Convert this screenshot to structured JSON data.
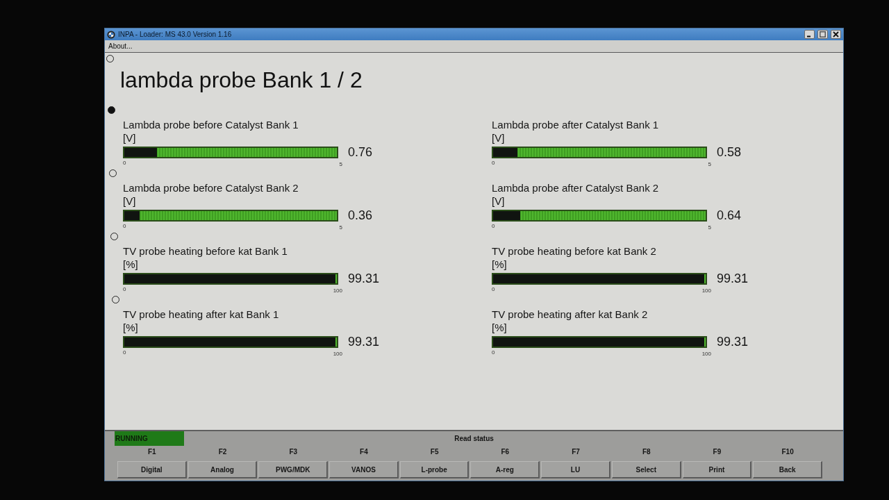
{
  "window": {
    "title": "INPA - Loader: MS 43.0 Version 1.16"
  },
  "menu": [
    "About..."
  ],
  "page_markers": [
    {
      "selected": false
    },
    {
      "selected": true
    },
    {
      "selected": false
    },
    {
      "selected": false
    },
    {
      "selected": false
    }
  ],
  "heading": "lambda probe Bank 1 / 2",
  "columns": [
    [
      {
        "label": "Lambda probe before Catalyst Bank 1",
        "unit": "[V]",
        "value": "0.76",
        "scale_min": "0",
        "scale_max": "5",
        "level": 0.152
      },
      {
        "label": "Lambda probe before Catalyst Bank 2",
        "unit": "[V]",
        "value": "0.36",
        "scale_min": "0",
        "scale_max": "5",
        "level": 0.072
      },
      {
        "label": "TV probe heating before kat Bank 1",
        "unit": "[%]",
        "value": "99.31",
        "scale_min": "0",
        "scale_max": "100",
        "level": 0.9931
      },
      {
        "label": "TV probe heating after kat Bank 1",
        "unit": "[%]",
        "value": "99.31",
        "scale_min": "0",
        "scale_max": "100",
        "level": 0.9931
      }
    ],
    [
      {
        "label": "Lambda probe after Catalyst Bank 1",
        "unit": "[V]",
        "value": "0.58",
        "scale_min": "0",
        "scale_max": "5",
        "level": 0.116
      },
      {
        "label": "Lambda probe after Catalyst Bank 2",
        "unit": "[V]",
        "value": "0.64",
        "scale_min": "0",
        "scale_max": "5",
        "level": 0.128
      },
      {
        "label": "TV probe heating before kat Bank 2",
        "unit": "[%]",
        "value": "99.31",
        "scale_min": "0",
        "scale_max": "100",
        "level": 0.9931
      },
      {
        "label": "TV probe heating after kat Bank 2",
        "unit": "[%]",
        "value": "99.31",
        "scale_min": "0",
        "scale_max": "100",
        "level": 0.9931
      }
    ]
  ],
  "status_bar": {
    "indicator": "RUNNING",
    "message": "Read status"
  },
  "function_keys": [
    {
      "key": "F1",
      "label": "Digital"
    },
    {
      "key": "F2",
      "label": "Analog"
    },
    {
      "key": "F3",
      "label": "PWG/MDK"
    },
    {
      "key": "F4",
      "label": "VANOS"
    },
    {
      "key": "F5",
      "label": "L-probe"
    },
    {
      "key": "F6",
      "label": "A-reg"
    },
    {
      "key": "F7",
      "label": "LU"
    },
    {
      "key": "F8",
      "label": "Select"
    },
    {
      "key": "F9",
      "label": "Print"
    },
    {
      "key": "F10",
      "label": "Back"
    }
  ]
}
